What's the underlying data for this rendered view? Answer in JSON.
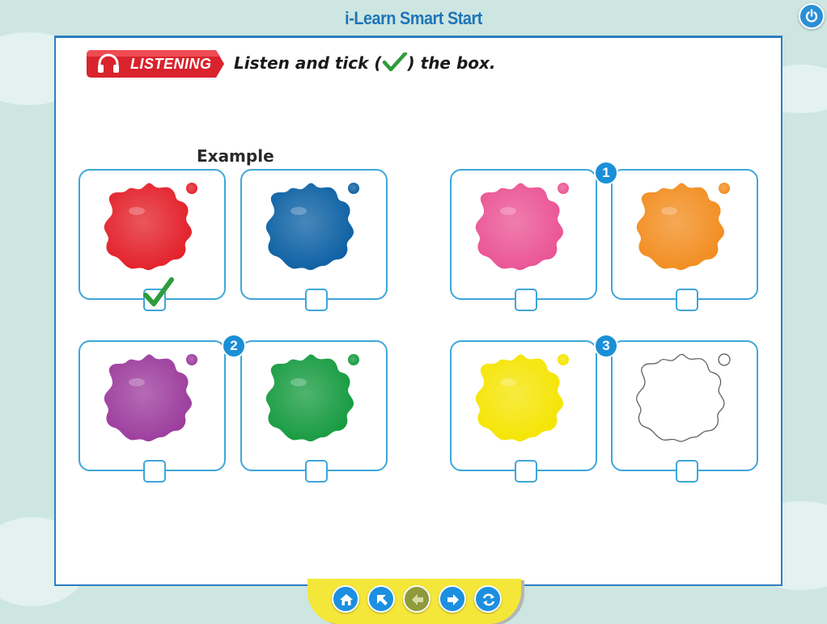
{
  "app": {
    "title": "i-Learn Smart Start"
  },
  "header": {
    "power_icon": "power-icon"
  },
  "exercise": {
    "section_label": "LISTENING",
    "instruction_before": "Listen and tick (",
    "instruction_after": ") the box.",
    "example_label": "Example"
  },
  "groups": [
    {
      "id": "example",
      "number": "",
      "left_color": "#e31e28",
      "right_color": "#0a5fa3",
      "checked": "left"
    },
    {
      "id": "q1",
      "number": "1",
      "left_color": "#ea5293",
      "right_color": "#f28c1e",
      "checked": "none"
    },
    {
      "id": "q2",
      "number": "2",
      "left_color": "#9b3a9c",
      "right_color": "#149a3e",
      "checked": "none"
    },
    {
      "id": "q3",
      "number": "3",
      "left_color": "#f5e400",
      "right_color": "#ffffff",
      "checked": "none"
    }
  ],
  "colors": {
    "accent": "#1d74b8",
    "card_border": "#3fa6d9",
    "tick": "#2e9c3a",
    "nav_bar": "#f4e73a"
  },
  "nav": [
    {
      "icon": "home-icon",
      "enabled": true
    },
    {
      "icon": "back-arrow-icon",
      "enabled": true
    },
    {
      "icon": "previous-icon",
      "enabled": false
    },
    {
      "icon": "next-icon",
      "enabled": true
    },
    {
      "icon": "refresh-icon",
      "enabled": true
    }
  ]
}
